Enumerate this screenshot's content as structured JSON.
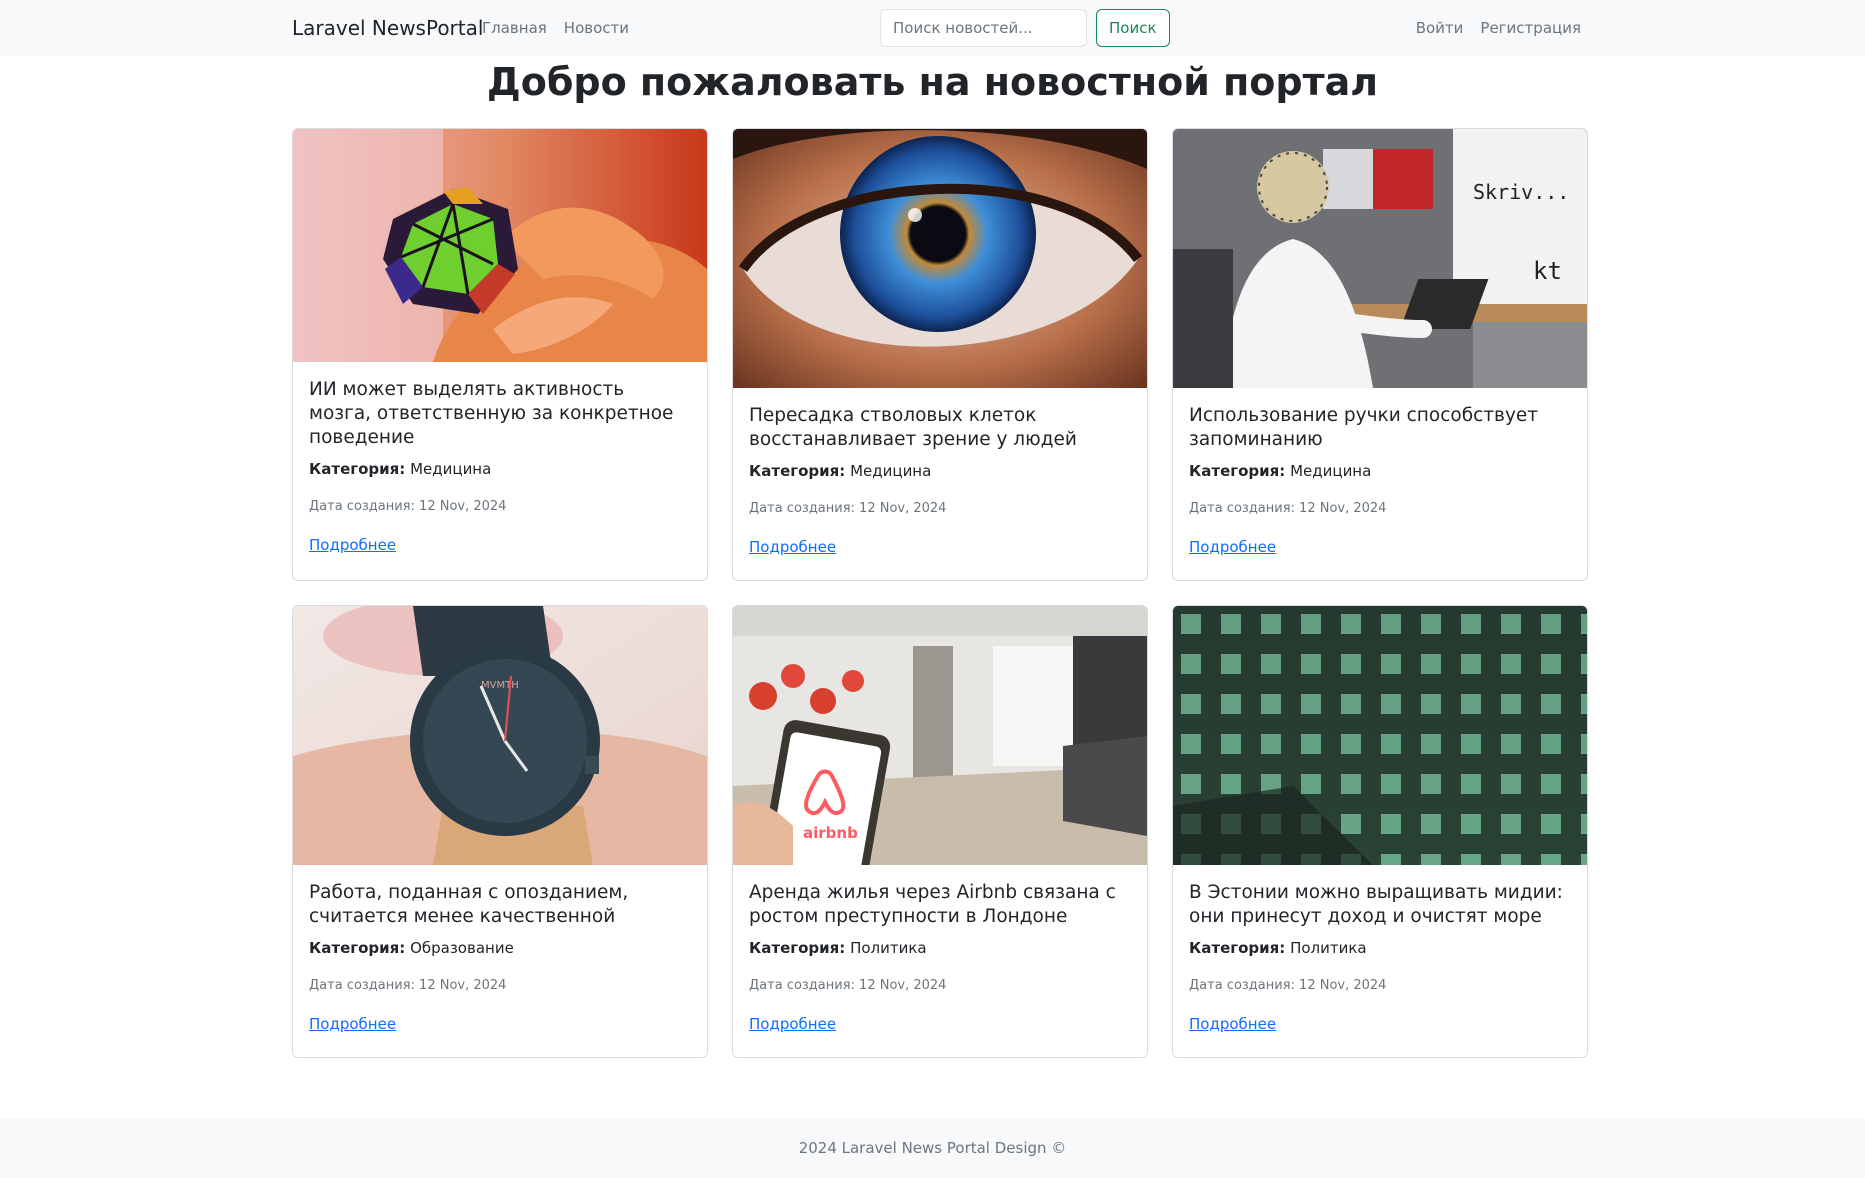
{
  "navbar": {
    "brand": "Laravel NewsPortal",
    "links": [
      "Главная",
      "Новости"
    ],
    "search": {
      "placeholder": "Поиск новостей...",
      "value": "",
      "button": "Поиск"
    },
    "auth": [
      "Войти",
      "Регистрация"
    ]
  },
  "page_title": "Добро пожаловать на новостной портал",
  "cards": [
    {
      "title": "ИИ может выделять активность мозга, ответственную за конкретное поведение",
      "category_label": "Категория:",
      "category": "Медицина",
      "date": "Дата создания: 12 Nov, 2024",
      "link": "Подробнее",
      "image": "rubiks-megaminx-photo"
    },
    {
      "title": "Пересадка стволовых клеток восстанавливает зрение у людей",
      "category_label": "Категория:",
      "category": "Медицина",
      "date": "Дата создания: 12 Nov, 2024",
      "link": "Подробнее",
      "image": "eye-closeup-photo"
    },
    {
      "title": "Использование ручки способствует запоминанию",
      "category_label": "Категория:",
      "category": "Медицина",
      "date": "Дата создания: 12 Nov, 2024",
      "link": "Подробнее",
      "image": "eeg-cap-writing-photo",
      "image_text": [
        "Skriv...",
        "kt"
      ]
    },
    {
      "title": "Работа, поданная с опозданием, считается менее качественной",
      "category_label": "Категория:",
      "category": "Образование",
      "date": "Дата создания: 12 Nov, 2024",
      "link": "Подробнее",
      "image": "wristwatch-photo",
      "image_text": [
        "MVMTH"
      ]
    },
    {
      "title": "Аренда жилья через Airbnb связана с ростом преступности в Лондоне",
      "category_label": "Категория:",
      "category": "Политика",
      "date": "Дата создания: 12 Nov, 2024",
      "link": "Подробнее",
      "image": "airbnb-apartment-photo",
      "image_text": [
        "airbnb"
      ]
    },
    {
      "title": "В Эстонии можно выращивать мидии: они принесут доход и очистят море",
      "category_label": "Категория:",
      "category": "Политика",
      "date": "Дата создания: 12 Nov, 2024",
      "link": "Подробнее",
      "image": "mussel-net-underwater-photo"
    }
  ],
  "footer": {
    "text": "2024 Laravel News Portal Design ©"
  },
  "colors": {
    "navbar_bg": "#f8f9fa",
    "link": "#0d6efd",
    "search_button": "#198754",
    "muted": "#6c757d"
  }
}
